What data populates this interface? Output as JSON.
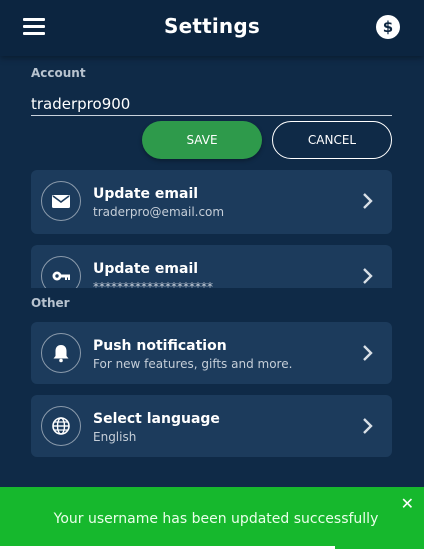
{
  "header": {
    "title": "Settings",
    "menu_icon": "hamburger-menu-icon",
    "right_icon": "dollar-icon",
    "dollar_glyph": "$"
  },
  "account": {
    "label": "Account",
    "username_value": "traderpro900",
    "save_label": "SAVE",
    "cancel_label": "CANCEL"
  },
  "settings": [
    {
      "title": "Update email",
      "subtitle": "traderpro@email.com",
      "icon": "envelope-icon"
    },
    {
      "title": "Update email",
      "subtitle": "********************",
      "icon": "key-icon"
    }
  ],
  "other": {
    "label": "Other",
    "items": [
      {
        "title": "Push notification",
        "subtitle": "For new features, gifts and more.",
        "icon": "bell-icon"
      },
      {
        "title": "Select language",
        "subtitle": "English",
        "icon": "globe-icon"
      }
    ]
  },
  "toast": {
    "message": "Your username has been updated successfully",
    "close_glyph": "✕",
    "progress": 0.79,
    "color": "#16b82d"
  },
  "colors": {
    "background": "#0f2a47",
    "card": "#1c3b5c",
    "save": "#2e9a4b"
  }
}
